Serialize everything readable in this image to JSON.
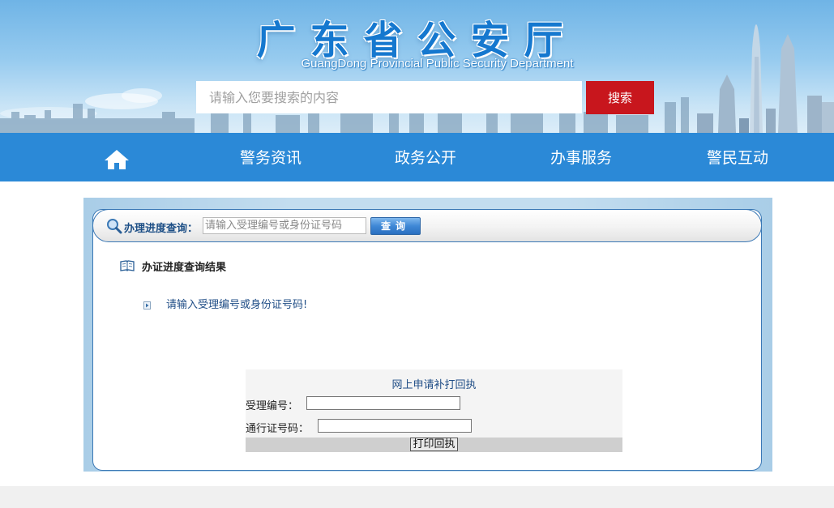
{
  "header": {
    "title_cn": "广东省公安厅",
    "title_en": "GuangDong Provincial Public Security Department",
    "search_placeholder": "请输入您要搜索的内容",
    "search_button": "搜索"
  },
  "nav": {
    "home_icon": "home-icon",
    "items": [
      {
        "label": "警务资讯"
      },
      {
        "label": "政务公开"
      },
      {
        "label": "办事服务"
      },
      {
        "label": "警民互动"
      }
    ]
  },
  "query": {
    "label": "办理进度查询：",
    "placeholder": "请输入受理编号或身份证号码",
    "button": "查询"
  },
  "result": {
    "title": "办证进度查询结果",
    "message": "请输入受理编号或身份证号码!"
  },
  "print_form": {
    "title": "网上申请补打回执",
    "field1_label": "受理编号：",
    "field2_label": "通行证号码：",
    "button": "打印回执"
  },
  "colors": {
    "nav_bg": "#2b89d7",
    "search_button_bg": "#c8161d",
    "title_blue": "#1578cf"
  }
}
